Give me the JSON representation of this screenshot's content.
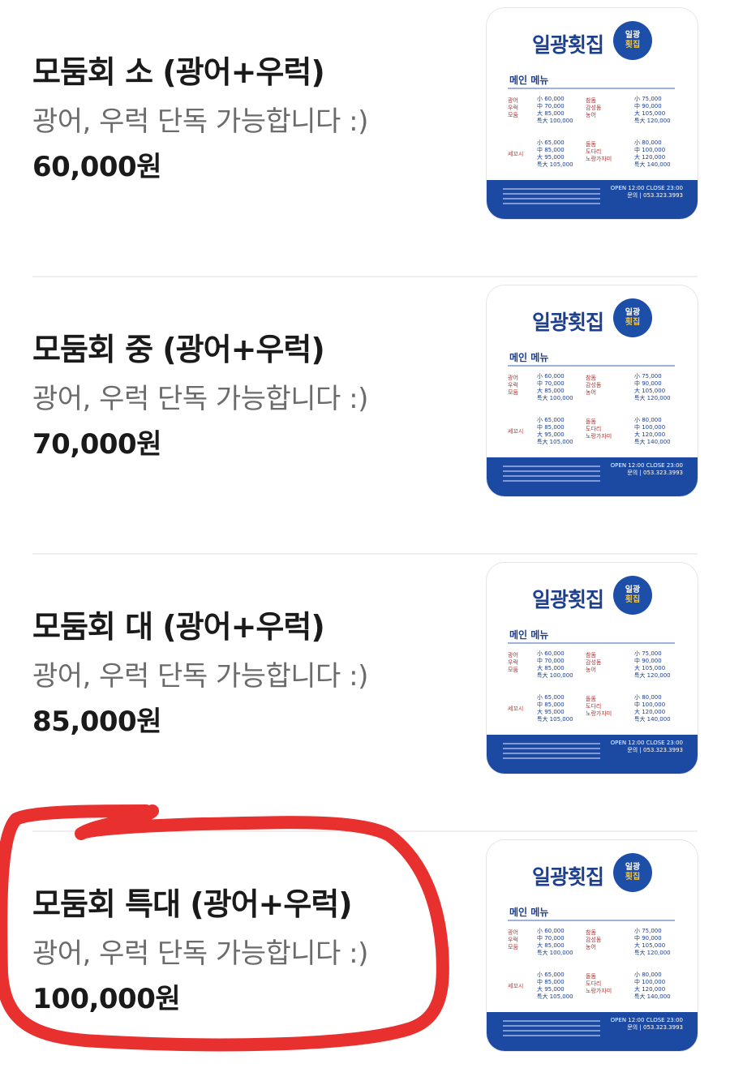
{
  "items": [
    {
      "name": "모둠회 소 (광어+우럭)",
      "desc": "광어, 우럭 단독 가능합니다 :)",
      "price": "60,000원"
    },
    {
      "name": "모둠회 중 (광어+우럭)",
      "desc": "광어, 우럭 단독 가능합니다 :)",
      "price": "70,000원"
    },
    {
      "name": "모둠회 대 (광어+우럭)",
      "desc": "광어, 우럭 단독 가능합니다 :)",
      "price": "85,000원"
    },
    {
      "name": "모둠회 특대 (광어+우럭)",
      "desc": "광어, 우럭 단독 가능합니다 :)",
      "price": "100,000원"
    }
  ],
  "thumbnail": {
    "brand": "일광횟집",
    "logo_top": "일광",
    "logo_bottom": "횟집",
    "menu_head": "메인 메뉴",
    "left_labels": [
      "광어",
      "우럭",
      "모둠"
    ],
    "left_prices": [
      "小 60,000",
      "中 70,000",
      "大 85,000",
      "특大 100,000"
    ],
    "mid_labels": [
      "참돔",
      "감성돔",
      "농어"
    ],
    "right_prices": [
      "小 75,000",
      "中 90,000",
      "大 105,000",
      "특大 120,000"
    ],
    "left2_label": "세꼬시",
    "left2_prices": [
      "小 65,000",
      "中 85,000",
      "大 95,000",
      "특大 105,000"
    ],
    "mid2_labels": [
      "돌돔",
      "도다리",
      "노랑가자미"
    ],
    "right2_prices": [
      "小 80,000",
      "中 100,000",
      "大 120,000",
      "특大 140,000"
    ],
    "open_line": "OPEN 12:00 CLOSE 23:00",
    "phone": "문의 | 053.323.3993"
  },
  "colors": {
    "brand_blue": "#1c3f8f",
    "annotation_red": "#e8312f"
  }
}
